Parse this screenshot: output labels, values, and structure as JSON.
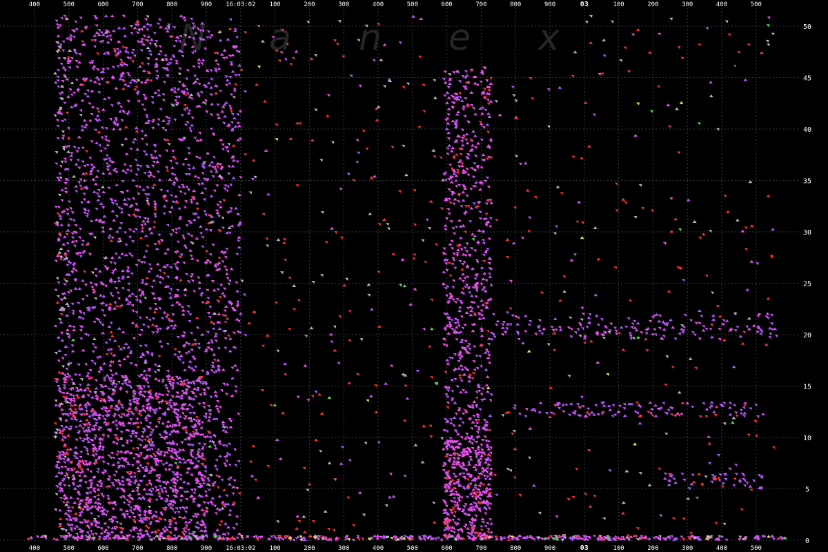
{
  "watermark": {
    "letters": [
      "N",
      "a",
      "n",
      "e",
      "x"
    ]
  },
  "colors": {
    "background": "#000000",
    "grid": "#3c3c3c",
    "label": "#ffffff",
    "watermark": "#262626",
    "purple": "#b455f5",
    "magenta": "#e650e6",
    "red": "#f03232",
    "gray": "#b4b4b4",
    "green": "#60d060",
    "yellow": "#e6e650"
  },
  "chart_data": {
    "type": "scatter",
    "title": "",
    "xlabel": "",
    "ylabel": "",
    "grid": true,
    "x_tick_labels": [
      "400",
      "500",
      "600",
      "700",
      "800",
      "900",
      "16:03:02",
      "100",
      "200",
      "300",
      "400",
      "500",
      "600",
      "700",
      "800",
      "900",
      "03",
      "100",
      "200",
      "300",
      "400",
      "500"
    ],
    "x_tick_bold": [
      false,
      false,
      false,
      false,
      false,
      false,
      false,
      false,
      false,
      false,
      false,
      false,
      false,
      false,
      false,
      false,
      true,
      false,
      false,
      false,
      false,
      false
    ],
    "y_tick_labels": [
      "0",
      "5",
      "10",
      "15",
      "20",
      "25",
      "30",
      "35",
      "40",
      "45",
      "50"
    ],
    "ylim": [
      0,
      51
    ],
    "x_range_ticks": [
      -0.2,
      21.9
    ],
    "series_colors": [
      "purple",
      "magenta",
      "red",
      "gray",
      "green",
      "yellow"
    ],
    "clusters": [
      {
        "x": [
          0.6,
          6.0
        ],
        "y": [
          0,
          51
        ],
        "density": 2300,
        "colors": {
          "purple": 0.5,
          "magenta": 0.4,
          "red": 0.07,
          "gray": 0.03
        }
      },
      {
        "x": [
          0.7,
          5.0
        ],
        "y": [
          0,
          16
        ],
        "density": 900,
        "colors": {
          "purple": 0.35,
          "magenta": 0.58,
          "red": 0.07
        }
      },
      {
        "x": [
          0.6,
          1.0
        ],
        "y": [
          0,
          51
        ],
        "density": 60,
        "colors": {
          "gray": 0.8,
          "red": 0.2
        }
      },
      {
        "x": [
          11.9,
          13.3
        ],
        "y": [
          0,
          46
        ],
        "density": 780,
        "colors": {
          "magenta": 0.55,
          "purple": 0.35,
          "red": 0.1
        }
      },
      {
        "x": [
          11.9,
          13.3
        ],
        "y": [
          0,
          10
        ],
        "density": 260,
        "colors": {
          "magenta": 0.75,
          "purple": 0.2,
          "red": 0.05
        }
      },
      {
        "x": [
          6.0,
          11.9
        ],
        "y": [
          0,
          51
        ],
        "density": 230,
        "colors": {
          "red": 0.55,
          "gray": 0.2,
          "purple": 0.15,
          "magenta": 0.1
        }
      },
      {
        "x": [
          13.3,
          21.6
        ],
        "y": [
          0,
          51
        ],
        "density": 240,
        "colors": {
          "red": 0.45,
          "gray": 0.3,
          "purple": 0.15,
          "magenta": 0.1
        }
      },
      {
        "x": [
          13.3,
          21.6
        ],
        "y": [
          19.5,
          22
        ],
        "density": 160,
        "colors": {
          "purple": 0.7,
          "magenta": 0.3
        }
      },
      {
        "x": [
          13.9,
          21.5
        ],
        "y": [
          12,
          13.4
        ],
        "density": 120,
        "colors": {
          "purple": 0.75,
          "red": 0.15,
          "magenta": 0.1
        }
      },
      {
        "x": [
          18.3,
          21.2
        ],
        "y": [
          5,
          6.5
        ],
        "density": 50,
        "colors": {
          "purple": 0.9,
          "red": 0.1
        }
      },
      {
        "x": [
          -0.2,
          21.9
        ],
        "y": [
          0,
          0.4
        ],
        "density": 450,
        "colors": {
          "purple": 0.45,
          "magenta": 0.3,
          "red": 0.1,
          "gray": 0.08,
          "yellow": 0.04,
          "green": 0.03
        }
      },
      {
        "x": [
          0.5,
          21.5
        ],
        "y": [
          0,
          51
        ],
        "density": 45,
        "colors": {
          "green": 0.45,
          "yellow": 0.3,
          "gray": 0.25
        }
      }
    ]
  }
}
